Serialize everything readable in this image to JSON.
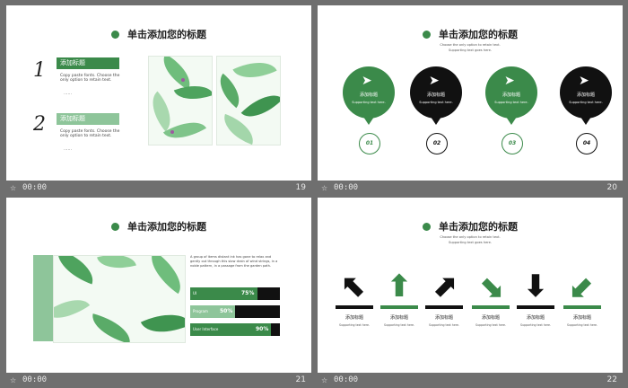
{
  "slides": [
    {
      "number": "19",
      "time": "00:00",
      "title": "单击添加您的标题",
      "items": [
        {
          "index": "1",
          "heading": "添加标题",
          "text": "Copy paste fonts. Choose the only option to retain text.",
          "more": "……"
        },
        {
          "index": "2",
          "heading": "添加标题",
          "text": "Copy paste fonts. Choose the only option to retain text.",
          "more": "……"
        }
      ]
    },
    {
      "number": "20",
      "time": "00:00",
      "title": "单击添加您的标题",
      "subtitle1": "Choose the only option to retain text.",
      "subtitle2": "Supporting text goes here.",
      "pins": [
        {
          "label": "添加标题",
          "text": "Supporting text here.",
          "num": "01",
          "color": "#3b8a4a"
        },
        {
          "label": "添加标题",
          "text": "Supporting text here.",
          "num": "02",
          "color": "#111111"
        },
        {
          "label": "添加标题",
          "text": "Supporting text here.",
          "num": "03",
          "color": "#3b8a4a"
        },
        {
          "label": "添加标题",
          "text": "Supporting text here.",
          "num": "04",
          "color": "#111111"
        }
      ]
    },
    {
      "number": "21",
      "time": "00:00",
      "title": "单击添加您的标题",
      "paragraph": "A group of items distant ink has gone to relax and gently out through this slow drain of wind strings, in a noble pattern, in a passage from the garden path.",
      "bars": [
        {
          "label": "UI",
          "value": "75%",
          "fraction": 0.75
        },
        {
          "label": "Program",
          "value": "50%",
          "fraction": 0.5
        },
        {
          "label": "User Interface",
          "value": "90%",
          "fraction": 0.9
        }
      ]
    },
    {
      "number": "22",
      "time": "00:00",
      "title": "单击添加您的标题",
      "subtitle1": "Choose the only option to retain text.",
      "subtitle2": "Supporting text goes here.",
      "arrows": [
        {
          "label": "添加标题",
          "text": "Supporting text here.",
          "icon": "arrow-up-left-icon",
          "color": "#111111"
        },
        {
          "label": "添加标题",
          "text": "Supporting text here.",
          "icon": "arrow-up-icon",
          "color": "#3b8a4a"
        },
        {
          "label": "添加标题",
          "text": "Supporting text here.",
          "icon": "arrow-up-right-icon",
          "color": "#111111"
        },
        {
          "label": "添加标题",
          "text": "Supporting text here.",
          "icon": "arrow-down-right-icon",
          "color": "#3b8a4a"
        },
        {
          "label": "添加标题",
          "text": "Supporting text here.",
          "icon": "arrow-down-icon",
          "color": "#111111"
        },
        {
          "label": "添加标题",
          "text": "Supporting text here.",
          "icon": "arrow-down-left-icon",
          "color": "#3b8a4a"
        }
      ]
    }
  ],
  "colors": {
    "accent": "#3b8a4a",
    "dark": "#111111",
    "light_accent": "#8ec59a"
  }
}
